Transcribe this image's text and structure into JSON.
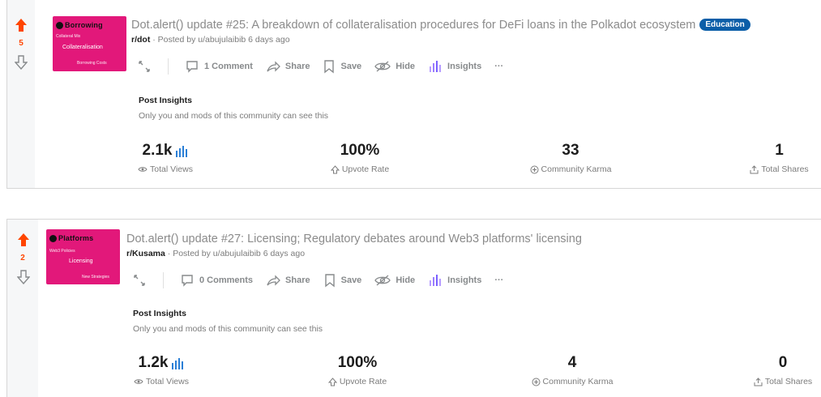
{
  "posts": [
    {
      "votes": "5",
      "thumb_word": "Borrowing",
      "thumb_mid": "Collateralisation",
      "thumb_small": [
        "Collateral Mix",
        "Borrowing Costs"
      ],
      "title": "Dot.alert() update #25: A breakdown of collateralisation procedures for DeFi loans in the Polkadot ecosystem",
      "flair": "Education",
      "subreddit": "r/dot",
      "posted_by": "· Posted by u/abujulaibib 6 days ago",
      "actions": {
        "comments": "1 Comment",
        "share": "Share",
        "save": "Save",
        "hide": "Hide",
        "insights": "Insights",
        "more": "···"
      },
      "insights_title": "Post Insights",
      "insights_note": "Only you and mods of this community can see this",
      "stats": {
        "views": "2.1k",
        "views_label": "Total Views",
        "upvote_rate": "100%",
        "upvote_label": "Upvote Rate",
        "karma": "33",
        "karma_label": "Community Karma",
        "shares": "1",
        "shares_label": "Total Shares"
      }
    },
    {
      "votes": "2",
      "thumb_word": "Platforms",
      "thumb_mid": "Licensing",
      "thumb_small": [
        "Web3 Policies",
        "New Strategies"
      ],
      "title": "Dot.alert() update #27: Licensing; Regulatory debates around Web3 platforms' licensing",
      "flair": "",
      "subreddit": "r/Kusama",
      "posted_by": "· Posted by u/abujulaibib 6 days ago",
      "actions": {
        "comments": "0 Comments",
        "share": "Share",
        "save": "Save",
        "hide": "Hide",
        "insights": "Insights",
        "more": "···"
      },
      "insights_title": "Post Insights",
      "insights_note": "Only you and mods of this community can see this",
      "stats": {
        "views": "1.2k",
        "views_label": "Total Views",
        "upvote_rate": "100%",
        "upvote_label": "Upvote Rate",
        "karma": "4",
        "karma_label": "Community Karma",
        "shares": "0",
        "shares_label": "Total Shares"
      }
    }
  ],
  "colors": {
    "upvote": "#ff4500",
    "flair": "#0b5ea8",
    "thumbnail": "#e2187a",
    "insights_icon": "#7b61ff"
  }
}
